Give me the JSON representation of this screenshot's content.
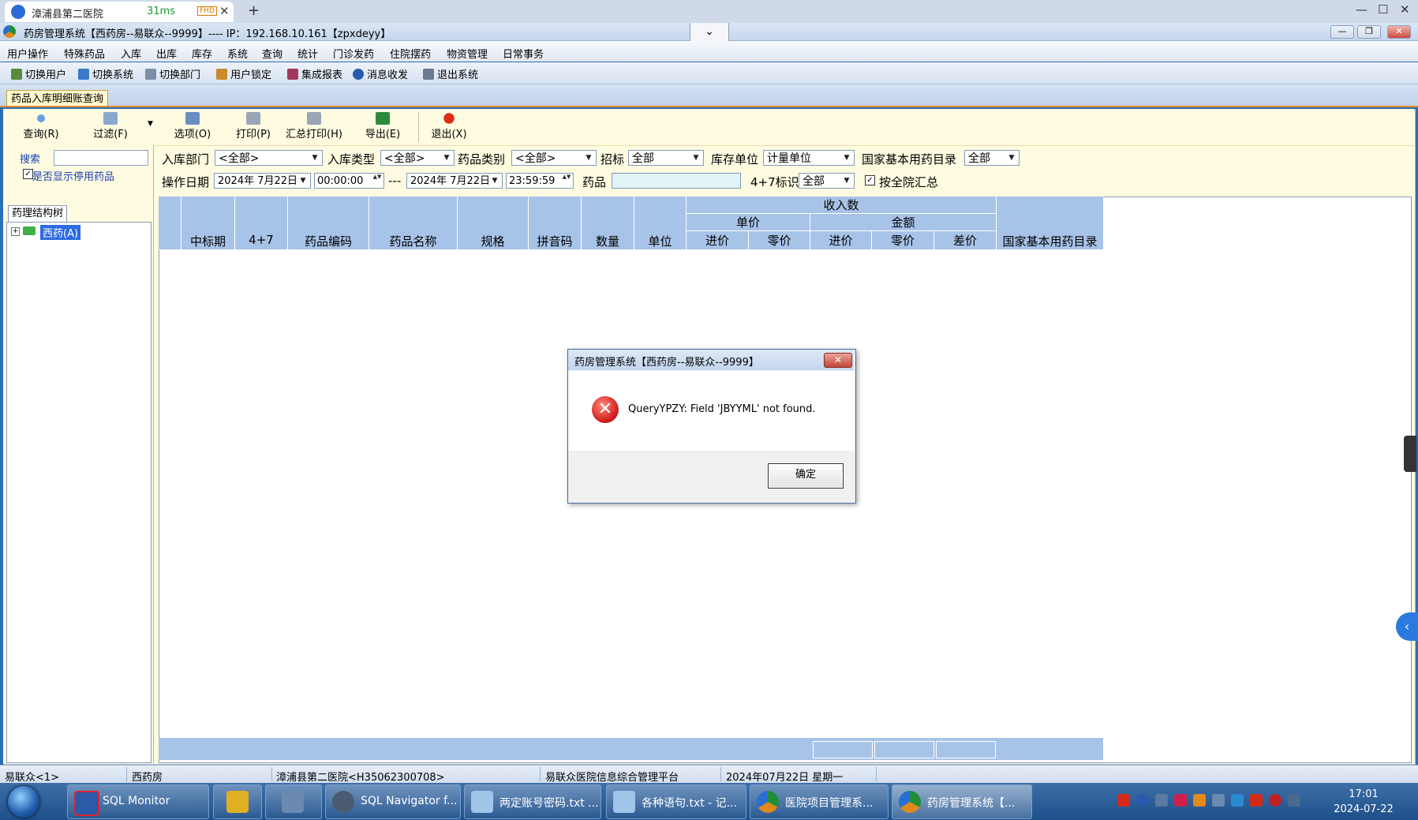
{
  "remote_tab": {
    "title": "漳浦县第二医院",
    "ping": "31ms",
    "quality": "FHD",
    "close": "✕",
    "new_tab": "+",
    "win_min": "—",
    "win_max": "☐",
    "win_close": "✕"
  },
  "app": {
    "title": "药房管理系统【西药房--易联众--9999】---- IP：192.168.10.161【zpxdeyy】",
    "dropdown": "⌄",
    "btn_min": "—",
    "btn_max": "❐",
    "btn_close": "✕"
  },
  "menu": [
    "用户操作",
    "特殊药品",
    "入库",
    "出库",
    "库存",
    "系统",
    "查询",
    "统计",
    "门诊发药",
    "住院摆药",
    "物资管理",
    "日常事务"
  ],
  "toolbar": [
    "切换用户",
    "切换系统",
    "切换部门",
    "用户锁定",
    "集成报表",
    "消息收发",
    "退出系统"
  ],
  "doc_tab": "药品入库明细账查询",
  "ribbon": [
    "查询(R)",
    "过滤(F)",
    "选项(O)",
    "打印(P)",
    "汇总打印(H)",
    "导出(E)",
    "退出(X)"
  ],
  "ribbon_more": "▼",
  "left": {
    "search_label": "搜索",
    "show_stopped": "是否显示停用药品",
    "show_stopped_checked": "✓",
    "tree_tab": "药理结构树",
    "tree_expand": "+",
    "tree_node": "西药(A)"
  },
  "filters": {
    "dept_label": "入库部门",
    "dept_value": "<全部>",
    "type_label": "入库类型",
    "type_value": "<全部>",
    "cat_label": "药品类别",
    "cat_value": "<全部>",
    "bid_label": "招标",
    "bid_value": "全部",
    "unit_label": "库存单位",
    "unit_value": "计量单位",
    "essential_label": "国家基本用药目录",
    "essential_value": "全部",
    "date_label": "操作日期",
    "date_from": "2024年 7月22日",
    "time_from": "00:00:00",
    "dash": "---",
    "date_to": "2024年 7月22日",
    "time_to": "23:59:59",
    "drug_label": "药品",
    "flag47_label": "4+7标识",
    "flag47_value": "全部",
    "all_hosp_label": "按全院汇总",
    "all_hosp_checked": "✓",
    "arrow": "▼",
    "spin": "▲▼"
  },
  "grid": {
    "group_income": "收入数",
    "group_price": "单价",
    "group_amount": "金额",
    "cols": [
      "中标期",
      "4+7",
      "药品编码",
      "药品名称",
      "规格",
      "拼音码",
      "数量",
      "单位",
      "进价",
      "零价",
      "进价",
      "零价",
      "差价",
      "国家基本用药目录"
    ]
  },
  "status": [
    "易联众<1>",
    "西药房",
    "漳浦县第二医院<H35062300708>",
    "易联众医院信息综合管理平台",
    "2024年07月22日 星期一"
  ],
  "taskbar": {
    "tasks": [
      "SQL Monitor",
      "",
      "",
      "SQL Navigator f...",
      "两定账号密码.txt ...",
      "各种语句.txt - 记...",
      "医院项目管理系...",
      "药房管理系统【..."
    ],
    "time": "17:01",
    "date": "2024-07-22"
  },
  "dialog": {
    "title": "药房管理系统【西药房--易联众--9999】",
    "close": "✕",
    "icon": "✕",
    "message": "QueryYPZY: Field 'JBYYML' not found.",
    "ok": "确定"
  },
  "side": {
    "collapse": "‹"
  },
  "colors": {
    "grid_header": "#a7c3e8",
    "panel_bg": "#fffbe0",
    "accent": "#e38c2a",
    "error": "#d21f1f"
  }
}
